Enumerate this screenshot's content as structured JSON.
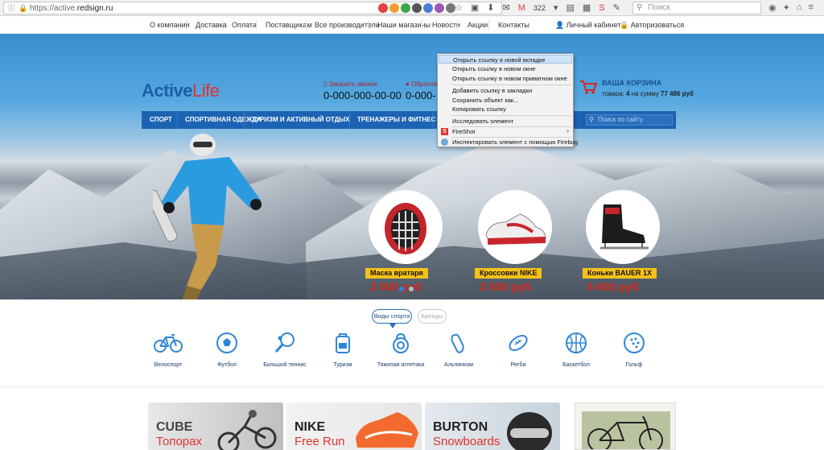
{
  "browser": {
    "url_prefix": "https://active.",
    "url_domain": "redsign.ru",
    "mail_count": "322",
    "search_placeholder": "Поиск"
  },
  "topnav": {
    "items": [
      "О компании",
      "Доставка",
      "Оплата",
      "Поставщикам",
      "Все производители",
      "Наши магазины",
      "Новости",
      "Акции",
      "Контакты"
    ],
    "account": "Личный кабинет",
    "login": "Авторизоваться"
  },
  "header": {
    "logo_part1": "Active",
    "logo_part2": "Life",
    "callback_label": "Заказать звонок",
    "phone1": "0-000-000-00-00",
    "feedback_label": "Обратная связь",
    "phone2": "0-000-",
    "cart_title": "ВАША КОРЗИНА",
    "cart_info_prefix": "товара:",
    "cart_count": "4",
    "cart_info_mid": "на сумму",
    "cart_total": "77 486 руб"
  },
  "mainnav": {
    "items": [
      "СПОРТ",
      "СПОРТИВНАЯ ОДЕЖДА",
      "ТУРИЗМ И АКТИВНЫЙ ОТДЫХ",
      "ТРЕНАЖЕРЫ И ФИТНЕС"
    ],
    "search_placeholder": "Поиск по сайту"
  },
  "products": [
    {
      "name": "Маска вратаря",
      "price": "2 000 руб"
    },
    {
      "name": "Кроссовки NIKE",
      "price": "2 000 руб"
    },
    {
      "name": "Коньки BAUER 1X",
      "price": "6 600 руб"
    }
  ],
  "context_menu": {
    "items": [
      "Открыть ссылку в новой вкладке",
      "Открыть ссылку в новом окне",
      "Открыть ссылку в новом приватном окне",
      "Добавить ссылку в закладки",
      "Сохранить объект как...",
      "Копировать ссылку",
      "Исследовать элемент",
      "FireShot",
      "Инспектировать элемент с помощью Firebug"
    ]
  },
  "sports_tabs": {
    "active": "Виды спорта",
    "inactive": "Бренды"
  },
  "sports": [
    "Велоспорт",
    "Футбол",
    "Большой теннис",
    "Туризм",
    "Тяжелая атлетика",
    "Альпинизм",
    "Регби",
    "Баскетбол",
    "Гольф"
  ],
  "brand_tiles": [
    {
      "brand": "CUBE",
      "sub": "Топорах"
    },
    {
      "brand": "NIKE",
      "sub": "Free Run"
    },
    {
      "brand": "BURTON",
      "sub": "Snowboards"
    }
  ],
  "colors": {
    "brand_blue": "#1d63b3",
    "accent_red": "#e2322c",
    "price_label_yellow": "#f6c21a",
    "icon_blue": "#2f86d6"
  }
}
